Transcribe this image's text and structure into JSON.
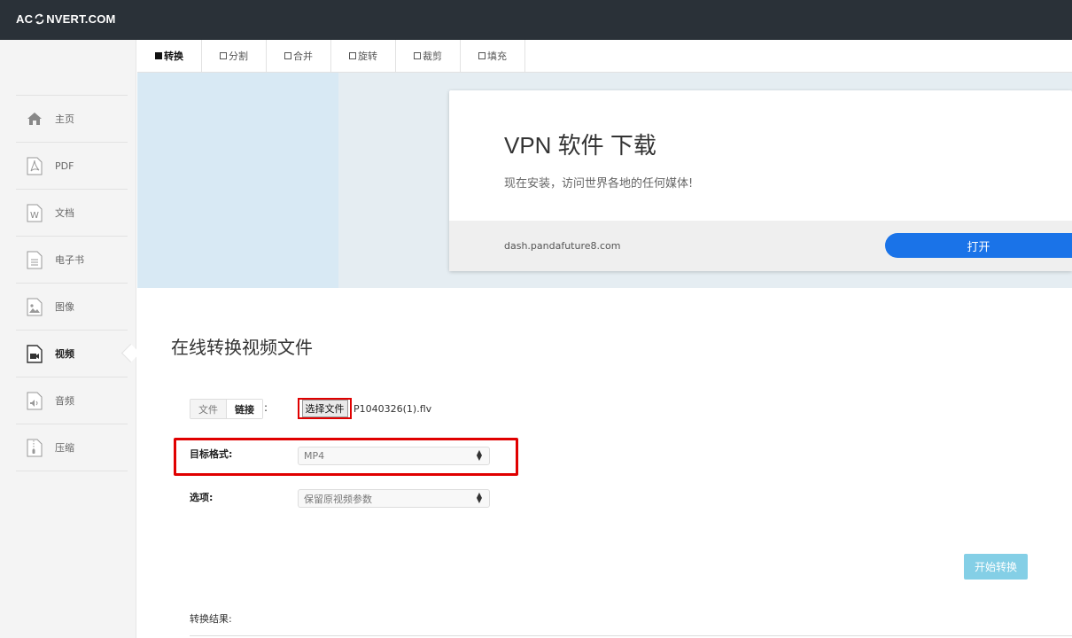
{
  "header": {
    "logo_left": "AC",
    "logo_right": "NVERT.COM",
    "logo_icon": "refresh-swirl-icon"
  },
  "sidebar": {
    "items": [
      {
        "label": "主页",
        "icon": "home-icon",
        "active": false
      },
      {
        "label": "PDF",
        "icon": "pdf-file-icon",
        "active": false
      },
      {
        "label": "文档",
        "icon": "word-document-icon",
        "active": false
      },
      {
        "label": "电子书",
        "icon": "ebook-file-icon",
        "active": false
      },
      {
        "label": "图像",
        "icon": "image-file-icon",
        "active": false
      },
      {
        "label": "视频",
        "icon": "video-file-icon",
        "active": true
      },
      {
        "label": "音频",
        "icon": "audio-file-icon",
        "active": false
      },
      {
        "label": "压缩",
        "icon": "archive-file-icon",
        "active": false
      }
    ]
  },
  "tabs": [
    {
      "label": "转换",
      "active": true
    },
    {
      "label": "分割",
      "active": false
    },
    {
      "label": "合并",
      "active": false
    },
    {
      "label": "旋转",
      "active": false
    },
    {
      "label": "裁剪",
      "active": false
    },
    {
      "label": "填充",
      "active": false
    }
  ],
  "ad": {
    "title": "VPN 软件 下载",
    "subtitle": "现在安装，访问世界各地的任何媒体!",
    "url": "dash.pandafuture8.com",
    "button": "打开"
  },
  "main": {
    "title": "在线转换视频文件",
    "source_tabs": {
      "file": "文件",
      "link": "链接",
      "colon": ":"
    },
    "file_button": "选择文件",
    "file_name": "P1040326(1).flv",
    "target_label": "目标格式:",
    "target_value": "MP4",
    "options_label": "选项:",
    "options_value": "保留原视频参数",
    "start_button": "开始转换",
    "result_label": "转换结果:"
  },
  "colors": {
    "topbar": "#2a3138",
    "accent_blue": "#1a73e8",
    "start_button": "#5bc0de",
    "highlight_red": "#e00000"
  }
}
